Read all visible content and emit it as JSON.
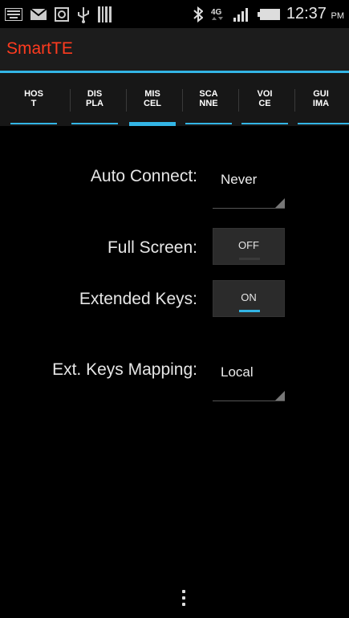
{
  "status_bar": {
    "time": "12:37",
    "ampm": "PM",
    "network": "4G",
    "icons": [
      "keyboard-icon",
      "email-icon",
      "media-icon",
      "usb-icon",
      "barcode-icon",
      "bluetooth-icon",
      "network-4g-icon",
      "signal-icon",
      "battery-icon"
    ]
  },
  "app": {
    "title": "SmartTE",
    "title_color": "#ff3b1f",
    "accent": "#33b5e5"
  },
  "tabs": [
    {
      "label": "HOS\nT",
      "active": false
    },
    {
      "label": "DIS\nPLA",
      "active": false
    },
    {
      "label": "MIS\nCEL",
      "active": true
    },
    {
      "label": "SCA\nNNE",
      "active": false
    },
    {
      "label": "VOI\nCE",
      "active": false
    },
    {
      "label": "GUI\nIMA",
      "active": false
    }
  ],
  "settings": {
    "auto_connect": {
      "label": "Auto Connect:",
      "value": "Never"
    },
    "full_screen": {
      "label": "Full Screen:",
      "value": "OFF",
      "on": false
    },
    "extended_keys": {
      "label": "Extended Keys:",
      "value": "ON",
      "on": true
    },
    "ext_keys_mapping": {
      "label": "Ext. Keys Mapping:",
      "value": "Local"
    }
  },
  "overflow_menu": {
    "icon": "overflow-menu-icon"
  }
}
